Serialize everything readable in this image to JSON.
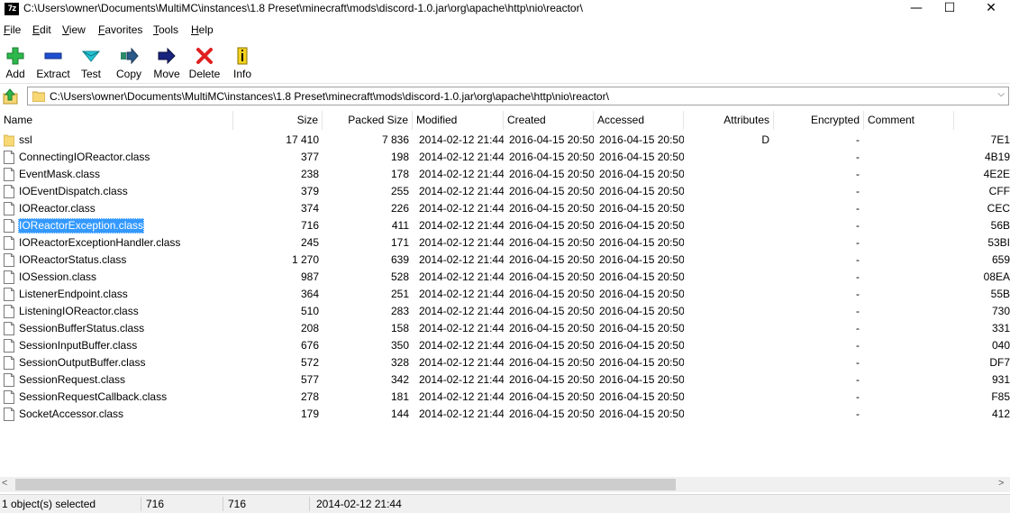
{
  "window": {
    "app_icon_text": "7z",
    "title": "C:\\Users\\owner\\Documents\\MultiMC\\instances\\1.8 Preset\\minecraft\\mods\\discord-1.0.jar\\org\\apache\\http\\nio\\reactor\\",
    "minimize_glyph": "—",
    "maximize_glyph": "☐",
    "close_glyph": "✕"
  },
  "menu": [
    "File",
    "Edit",
    "View",
    "Favorites",
    "Tools",
    "Help"
  ],
  "toolbar": {
    "add": "Add",
    "extract": "Extract",
    "test": "Test",
    "copy": "Copy",
    "move": "Move",
    "delete": "Delete",
    "info": "Info"
  },
  "address": {
    "path": "C:\\Users\\owner\\Documents\\MultiMC\\instances\\1.8 Preset\\minecraft\\mods\\discord-1.0.jar\\org\\apache\\http\\nio\\reactor\\",
    "dropdown_glyph": "⌵"
  },
  "columns": {
    "name": "Name",
    "size": "Size",
    "packed": "Packed Size",
    "modified": "Modified",
    "created": "Created",
    "accessed": "Accessed",
    "attributes": "Attributes",
    "encrypted": "Encrypted",
    "comment": "Comment"
  },
  "rows": [
    {
      "name": "ssl",
      "type": "folder",
      "size": "17 410",
      "packed": "7 836",
      "modified": "2014-02-12 21:44",
      "created": "2016-04-15 20:50",
      "accessed": "2016-04-15 20:50",
      "attributes": "D",
      "encrypted": "-",
      "crc": "7E1"
    },
    {
      "name": "ConnectingIOReactor.class",
      "type": "file",
      "size": "377",
      "packed": "198",
      "modified": "2014-02-12 21:44",
      "created": "2016-04-15 20:50",
      "accessed": "2016-04-15 20:50",
      "attributes": "",
      "encrypted": "-",
      "crc": "4B19"
    },
    {
      "name": "EventMask.class",
      "type": "file",
      "size": "238",
      "packed": "178",
      "modified": "2014-02-12 21:44",
      "created": "2016-04-15 20:50",
      "accessed": "2016-04-15 20:50",
      "attributes": "",
      "encrypted": "-",
      "crc": "4E2E"
    },
    {
      "name": "IOEventDispatch.class",
      "type": "file",
      "size": "379",
      "packed": "255",
      "modified": "2014-02-12 21:44",
      "created": "2016-04-15 20:50",
      "accessed": "2016-04-15 20:50",
      "attributes": "",
      "encrypted": "-",
      "crc": "CFF"
    },
    {
      "name": "IOReactor.class",
      "type": "file",
      "size": "374",
      "packed": "226",
      "modified": "2014-02-12 21:44",
      "created": "2016-04-15 20:50",
      "accessed": "2016-04-15 20:50",
      "attributes": "",
      "encrypted": "-",
      "crc": "CEC"
    },
    {
      "name": "IOReactorException.class",
      "type": "file",
      "size": "716",
      "packed": "411",
      "modified": "2014-02-12 21:44",
      "created": "2016-04-15 20:50",
      "accessed": "2016-04-15 20:50",
      "attributes": "",
      "encrypted": "-",
      "crc": "56B",
      "selected": true
    },
    {
      "name": "IOReactorExceptionHandler.class",
      "type": "file",
      "size": "245",
      "packed": "171",
      "modified": "2014-02-12 21:44",
      "created": "2016-04-15 20:50",
      "accessed": "2016-04-15 20:50",
      "attributes": "",
      "encrypted": "-",
      "crc": "53BI"
    },
    {
      "name": "IOReactorStatus.class",
      "type": "file",
      "size": "1 270",
      "packed": "639",
      "modified": "2014-02-12 21:44",
      "created": "2016-04-15 20:50",
      "accessed": "2016-04-15 20:50",
      "attributes": "",
      "encrypted": "-",
      "crc": "659"
    },
    {
      "name": "IOSession.class",
      "type": "file",
      "size": "987",
      "packed": "528",
      "modified": "2014-02-12 21:44",
      "created": "2016-04-15 20:50",
      "accessed": "2016-04-15 20:50",
      "attributes": "",
      "encrypted": "-",
      "crc": "08EA"
    },
    {
      "name": "ListenerEndpoint.class",
      "type": "file",
      "size": "364",
      "packed": "251",
      "modified": "2014-02-12 21:44",
      "created": "2016-04-15 20:50",
      "accessed": "2016-04-15 20:50",
      "attributes": "",
      "encrypted": "-",
      "crc": "55B"
    },
    {
      "name": "ListeningIOReactor.class",
      "type": "file",
      "size": "510",
      "packed": "283",
      "modified": "2014-02-12 21:44",
      "created": "2016-04-15 20:50",
      "accessed": "2016-04-15 20:50",
      "attributes": "",
      "encrypted": "-",
      "crc": "730"
    },
    {
      "name": "SessionBufferStatus.class",
      "type": "file",
      "size": "208",
      "packed": "158",
      "modified": "2014-02-12 21:44",
      "created": "2016-04-15 20:50",
      "accessed": "2016-04-15 20:50",
      "attributes": "",
      "encrypted": "-",
      "crc": "331"
    },
    {
      "name": "SessionInputBuffer.class",
      "type": "file",
      "size": "676",
      "packed": "350",
      "modified": "2014-02-12 21:44",
      "created": "2016-04-15 20:50",
      "accessed": "2016-04-15 20:50",
      "attributes": "",
      "encrypted": "-",
      "crc": "040"
    },
    {
      "name": "SessionOutputBuffer.class",
      "type": "file",
      "size": "572",
      "packed": "328",
      "modified": "2014-02-12 21:44",
      "created": "2016-04-15 20:50",
      "accessed": "2016-04-15 20:50",
      "attributes": "",
      "encrypted": "-",
      "crc": "DF7"
    },
    {
      "name": "SessionRequest.class",
      "type": "file",
      "size": "577",
      "packed": "342",
      "modified": "2014-02-12 21:44",
      "created": "2016-04-15 20:50",
      "accessed": "2016-04-15 20:50",
      "attributes": "",
      "encrypted": "-",
      "crc": "931"
    },
    {
      "name": "SessionRequestCallback.class",
      "type": "file",
      "size": "278",
      "packed": "181",
      "modified": "2014-02-12 21:44",
      "created": "2016-04-15 20:50",
      "accessed": "2016-04-15 20:50",
      "attributes": "",
      "encrypted": "-",
      "crc": "F85"
    },
    {
      "name": "SocketAccessor.class",
      "type": "file",
      "size": "179",
      "packed": "144",
      "modified": "2014-02-12 21:44",
      "created": "2016-04-15 20:50",
      "accessed": "2016-04-15 20:50",
      "attributes": "",
      "encrypted": "-",
      "crc": "412"
    }
  ],
  "scrollbar": {
    "left_arrow": "<",
    "right_arrow": ">"
  },
  "status": {
    "selection": "1 object(s) selected",
    "size": "716",
    "packed": "716",
    "modified": "2014-02-12 21:44"
  },
  "colors": {
    "selection_bg": "#3399ff",
    "folder_yellow": "#f8d775",
    "add_green": "#2db84b",
    "extract_blue": "#1f4fd1",
    "test_cyan": "#22c5d6",
    "delete_red": "#e02020",
    "info_yellow": "#f4d21f"
  }
}
